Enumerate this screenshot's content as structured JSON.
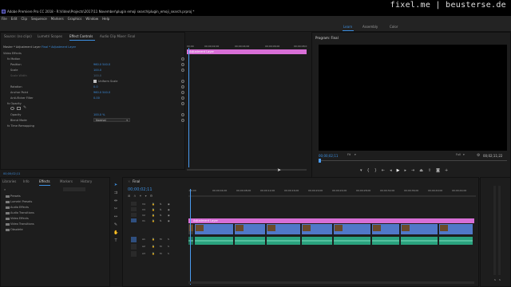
{
  "window": {
    "title": "Adobe Premiere Pro CC 2018 - R:\\Video\\Projects\\2017\\11 November\\plugin emoji search\\plugin_emoji_search.prproj *",
    "watermark": "fixel.me | beusterse.de"
  },
  "menu": [
    "File",
    "Edit",
    "Clip",
    "Sequence",
    "Markers",
    "Graphics",
    "Window",
    "Help"
  ],
  "workspaces": {
    "items": [
      "Learn",
      "Assembly",
      "Color"
    ],
    "active": 0
  },
  "effect_controls": {
    "tabs": [
      "Source: (no clips)",
      "Lumetri Scopes",
      "Effect Controls",
      "Audio Clip Mixer: Final"
    ],
    "active_tab": 2,
    "header": "Master * Adjustment Layer",
    "header_seq": "Final * Adjustment Layer",
    "section": "Video Effects",
    "rows": [
      {
        "label": "fx  Motion",
        "value": ""
      },
      {
        "label": "Position",
        "value": "960.0   540.0"
      },
      {
        "label": "Scale",
        "value": "100.0"
      },
      {
        "label": "Scale Width",
        "value": "100.0"
      },
      {
        "label": "Uniform Scale",
        "value": ""
      },
      {
        "label": "Rotation",
        "value": "0.0"
      },
      {
        "label": "Anchor Point",
        "value": "960.0   540.0"
      },
      {
        "label": "Anti-flicker Filter",
        "value": "0.00"
      },
      {
        "label": "fx  Opacity",
        "value": ""
      },
      {
        "label": "Opacity",
        "value": "100.0 %"
      },
      {
        "label": "Blend Mode",
        "value": "Normal"
      },
      {
        "label": "fx  Time Remapping",
        "value": ""
      }
    ],
    "timecode": "00;00;02;11",
    "clip_label": "Adjustment Layer",
    "ruler": [
      "00;00",
      "00;00;02;00",
      "00;00;04;00",
      "00;00;06;00",
      "00;00;08;0"
    ]
  },
  "program": {
    "title": "Program: Final",
    "timecode_left": "00;00;02;11",
    "fit": "Fit",
    "full": "Full",
    "timecode_right": "00;02;11;22"
  },
  "project": {
    "tabs": [
      "Libraries",
      "Info",
      "Effects",
      "Markers",
      "History"
    ],
    "active_tab": 2,
    "items": [
      "Presets",
      "Lumetri Presets",
      "Audio Effects",
      "Audio Transitions",
      "Video Effects",
      "Video Transitions",
      "Obsolete"
    ]
  },
  "timeline": {
    "sequence": "Final",
    "timecode": "00;00;02;11",
    "ruler": [
      ":00;00",
      "00;00;04;00",
      "00;00;08;00",
      "00;00;12;00",
      "00;00;16;00",
      "00;00;20;00",
      "00;00;24;00",
      "00;00;28;00",
      "00;00;32;00",
      "00;00;36;00",
      "00;00;40;00",
      "00;00;44;00"
    ],
    "tracks_video": [
      "V4",
      "V3",
      "V2",
      "V1"
    ],
    "tracks_audio": [
      "A1",
      "A2",
      "A3"
    ],
    "adjustment_label": "Adjustment Layer"
  },
  "colors": {
    "accent": "#3d8fe0",
    "adjustment": "#d86fd6",
    "video_clip": "#5078c8",
    "audio_clip": "#2aa27e",
    "playhead": "#4a9bf0"
  }
}
